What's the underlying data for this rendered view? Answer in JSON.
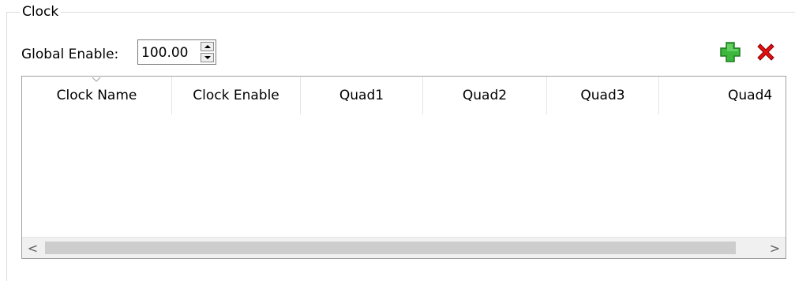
{
  "group": {
    "title": "Clock"
  },
  "global_enable": {
    "label": "Global Enable:",
    "value": "100.00"
  },
  "toolbar": {
    "add_icon": "plus-icon",
    "delete_icon": "x-icon"
  },
  "table": {
    "columns": [
      "Clock Name",
      "Clock Enable",
      "Quad1",
      "Quad2",
      "Quad3",
      "Quad4"
    ],
    "rows": []
  },
  "scrollbar": {
    "left_arrow": "<",
    "right_arrow": ">"
  },
  "colors": {
    "add_green": "#3cb83c",
    "delete_red": "#e01010"
  }
}
